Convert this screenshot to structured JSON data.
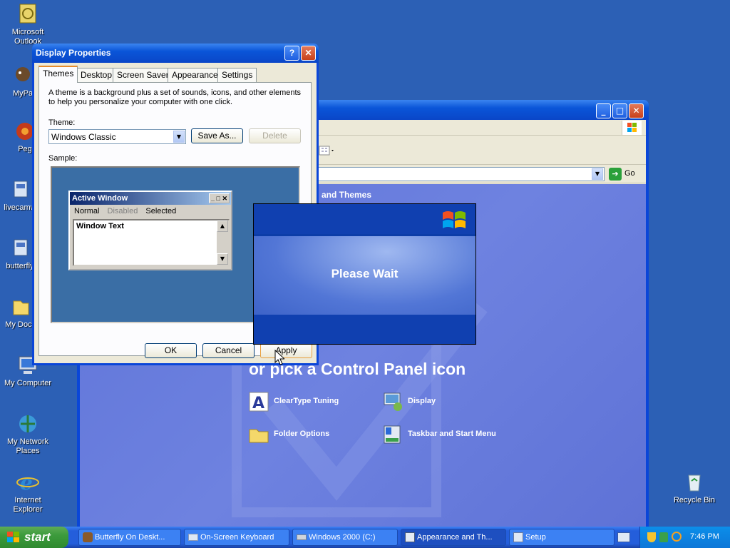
{
  "desktop_icons": [
    {
      "label": "Microsoft Outlook",
      "icon": "outlook-icon"
    },
    {
      "label": "MyPa",
      "icon": "mypa-icon"
    },
    {
      "label": "Peg",
      "icon": "peg-icon"
    },
    {
      "label": "livecamw",
      "icon": "livecam-icon"
    },
    {
      "label": "butterfly",
      "icon": "butterfly-icon"
    },
    {
      "label": "My Docu",
      "icon": "my-documents-icon"
    },
    {
      "label": "My Computer",
      "icon": "my-computer-icon"
    },
    {
      "label": "My Network Places",
      "icon": "network-icon"
    },
    {
      "label": "Internet Explorer",
      "icon": "ie-icon"
    },
    {
      "label": "Recycle Bin",
      "icon": "recycle-bin-icon"
    }
  ],
  "control_panel": {
    "go_label": "Go",
    "category_text": "and Themes",
    "heading": "or pick a Control Panel icon",
    "icons": [
      {
        "label": "ClearType Tuning",
        "icon": "cleartype-icon"
      },
      {
        "label": "Display",
        "icon": "display-icon"
      },
      {
        "label": "Folder Options",
        "icon": "folder-options-icon"
      },
      {
        "label": "Taskbar and Start Menu",
        "icon": "taskbar-icon"
      }
    ]
  },
  "display_properties": {
    "title": "Display Properties",
    "tabs": [
      "Themes",
      "Desktop",
      "Screen Saver",
      "Appearance",
      "Settings"
    ],
    "description": "A theme is a background plus a set of sounds, icons, and other elements to help you personalize your computer with one click.",
    "theme_label": "Theme:",
    "theme_value": "Windows Classic",
    "save_as": "Save As...",
    "delete": "Delete",
    "sample_label": "Sample:",
    "sample": {
      "title": "Active Window",
      "normal": "Normal",
      "disabled": "Disabled",
      "selected": "Selected",
      "text": "Window Text"
    },
    "ok": "OK",
    "cancel": "Cancel",
    "apply": "Apply"
  },
  "please_wait": {
    "text": "Please Wait"
  },
  "taskbar": {
    "start": "start",
    "items": [
      "Butterfly On Deskt...",
      "On-Screen Keyboard",
      "Windows 2000 (C:)",
      "Appearance and Th...",
      "Setup"
    ],
    "clock": "7:46 PM"
  }
}
